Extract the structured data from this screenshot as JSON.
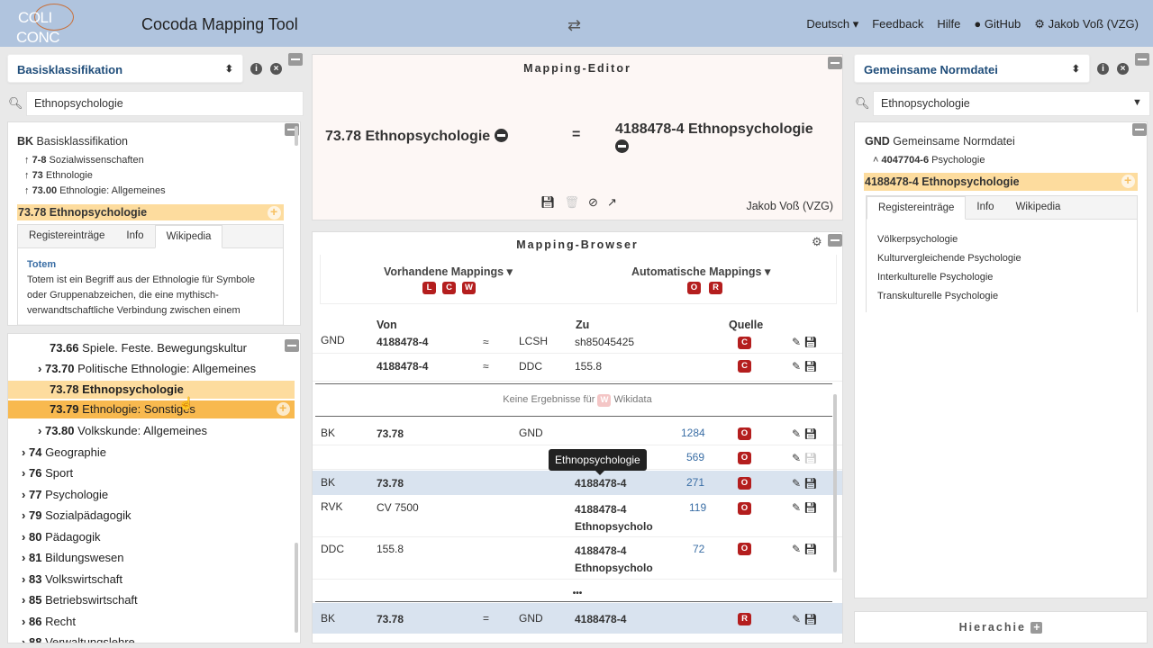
{
  "app": {
    "title": "Cocoda Mapping Tool",
    "logo_line1": "COLI",
    "logo_line2": "CONC"
  },
  "nav": {
    "language": "Deutsch",
    "feedback": "Feedback",
    "help": "Hilfe",
    "github": "GitHub",
    "user": "Jakob Voß (VZG)"
  },
  "left": {
    "scheme": "Basisklassifikation",
    "search_value": "Ethnopsychologie",
    "concept": {
      "scheme_notation": "BK",
      "scheme_label": "Basisklassifikation",
      "ancestors": [
        {
          "notation": "7-8",
          "label": "Sozialwissenschaften"
        },
        {
          "notation": "73",
          "label": "Ethnologie"
        },
        {
          "notation": "73.00",
          "label": "Ethnologie: Allgemeines"
        }
      ],
      "selected": "73.78 Ethnopsychologie",
      "tabs": [
        "Registereinträge",
        "Info",
        "Wikipedia"
      ],
      "wiki_title": "Totem",
      "wiki_text": "Totem ist ein Begriff aus der Ethnologie für Symbole oder Gruppenabzeichen, die eine mythisch-verwandtschaftliche Verbindung zwischen einem"
    },
    "tree": [
      {
        "notation": "73.66",
        "label": "Spiele. Feste. Bewegungskultur",
        "arrow": ""
      },
      {
        "notation": "73.70",
        "label": "Politische Ethnologie: Allgemeines",
        "arrow": "›"
      },
      {
        "notation": "73.78",
        "label": "Ethnopsychologie",
        "arrow": ""
      },
      {
        "notation": "73.79",
        "label": "Ethnologie: Sonstiges",
        "arrow": ""
      },
      {
        "notation": "73.80",
        "label": "Volkskunde: Allgemeines",
        "arrow": "›"
      },
      {
        "notation": "74",
        "label": "Geographie",
        "arrow": "›"
      },
      {
        "notation": "76",
        "label": "Sport",
        "arrow": "›"
      },
      {
        "notation": "77",
        "label": "Psychologie",
        "arrow": "›"
      },
      {
        "notation": "79",
        "label": "Sozialpädagogik",
        "arrow": "›"
      },
      {
        "notation": "80",
        "label": "Pädagogik",
        "arrow": "›"
      },
      {
        "notation": "81",
        "label": "Bildungswesen",
        "arrow": "›"
      },
      {
        "notation": "83",
        "label": "Volkswirtschaft",
        "arrow": "›"
      },
      {
        "notation": "85",
        "label": "Betriebswirtschaft",
        "arrow": "›"
      },
      {
        "notation": "86",
        "label": "Recht",
        "arrow": "›"
      },
      {
        "notation": "88",
        "label": "Verwaltungslehre",
        "arrow": "›"
      }
    ]
  },
  "editor": {
    "title": "Mapping-Editor",
    "from": "73.78 Ethnopsychologie",
    "relation": "=",
    "to": "4188478-4 Ethnopsychologie",
    "creator": "Jakob Voß (VZG)"
  },
  "browser": {
    "title": "Mapping-Browser",
    "existing": "Vorhandene Mappings",
    "existing_badges": [
      "L",
      "C",
      "W"
    ],
    "auto": "Automatische Mappings",
    "auto_badges": [
      "O",
      "R"
    ],
    "headers": {
      "from": "Von",
      "to": "Zu",
      "source": "Quelle"
    },
    "rows_top": [
      {
        "scheme": "GND",
        "from": "4188478-4",
        "rel": "≈",
        "toscheme": "LCSH",
        "to": "sh85045425",
        "badge": "C"
      },
      {
        "scheme": "",
        "from": "4188478-4",
        "rel": "≈",
        "toscheme": "DDC",
        "to": "155.8",
        "badge": "C"
      }
    ],
    "no_results": "Keine Ergebnisse für",
    "no_results_badge": "W",
    "no_results_target": "Wikidata",
    "rows_mid": [
      {
        "scheme": "BK",
        "from": "73.78",
        "toscheme": "GND",
        "to": "",
        "count": "1284",
        "badge": "O"
      },
      {
        "scheme": "",
        "from": "",
        "toscheme": "",
        "to": "",
        "count": "569",
        "badge": "O"
      },
      {
        "scheme": "BK",
        "from": "73.78",
        "toscheme": "",
        "to": "4188478-4",
        "count": "271",
        "badge": "O"
      },
      {
        "scheme": "RVK",
        "from": "CV 7500",
        "toscheme": "",
        "to": "4188478-4",
        "to2": "Ethnopsycholo",
        "count": "119",
        "badge": "O"
      },
      {
        "scheme": "DDC",
        "from": "155.8",
        "toscheme": "",
        "to": "4188478-4",
        "to2": "Ethnopsycholo",
        "count": "72",
        "badge": "O"
      }
    ],
    "ellipsis": "•••",
    "rows_bottom": [
      {
        "scheme": "BK",
        "from": "73.78",
        "rel": "=",
        "toscheme": "GND",
        "to": "4188478-4",
        "badge": "R"
      }
    ],
    "tooltip": "Ethnopsychologie"
  },
  "right": {
    "scheme": "Gemeinsame Normdatei",
    "search_value": "Ethnopsychologie",
    "scheme_notation": "GND",
    "scheme_label": "Gemeinsame Normdatei",
    "broader_notation": "4047704-6",
    "broader_label": "Psychologie",
    "selected": "4188478-4 Ethnopsychologie",
    "tabs": [
      "Registereinträge",
      "Info",
      "Wikipedia"
    ],
    "entries": [
      "Völkerpsychologie",
      "Kulturvergleichende Psychologie",
      "Interkulturelle Psychologie",
      "Transkulturelle Psychologie"
    ],
    "hierarchy": "Hierachie"
  }
}
